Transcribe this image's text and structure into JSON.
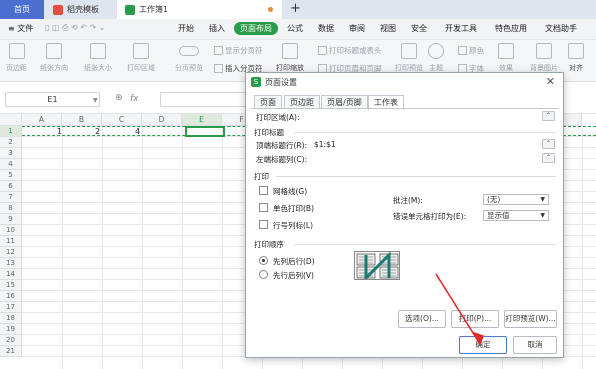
{
  "tabs": {
    "home": "首页",
    "template": "稻壳模板",
    "workbook": "工作簿1",
    "add": "+"
  },
  "menu": {
    "file": "≡ 文件",
    "items": [
      "开始",
      "插入",
      "页面布局",
      "公式",
      "数据",
      "审阅",
      "视图",
      "安全",
      "开发工具",
      "特色应用",
      "文档助手"
    ],
    "active": "页面布局"
  },
  "toolbar": {
    "margins": "页边距",
    "orientation": "纸张方向",
    "size": "纸张大小",
    "print_area": "打印区域",
    "preview": "分页预览",
    "show_break": "显示分页符",
    "insert_break": "插入分页符",
    "print_scale": "打印缩放",
    "print_title": "打印标题或表头",
    "print_header_footer": "打印页眉和页脚",
    "print_preview": "打印预览",
    "theme": "主题",
    "colors": "颜色",
    "fonts": "字体",
    "effects": "效果",
    "background": "背景图片",
    "align": "对齐"
  },
  "formula": {
    "cell": "E1",
    "fx": "fx"
  },
  "sheet": {
    "columns": [
      "A",
      "B",
      "C",
      "D",
      "E",
      "F",
      "G",
      "H",
      "I",
      "J",
      "K",
      "L",
      "M",
      "N"
    ],
    "rows": [
      "1",
      "2",
      "3",
      "4",
      "5",
      "6",
      "7",
      "8",
      "9",
      "10",
      "11",
      "12",
      "13",
      "14",
      "15",
      "16",
      "17",
      "18",
      "19",
      "20",
      "21"
    ],
    "values": [
      "1",
      "2",
      "4"
    ]
  },
  "dialog": {
    "title": "页面设置",
    "tabs": [
      "页面",
      "页边距",
      "页眉/页脚",
      "工作表"
    ],
    "print_area": "打印区域(A):",
    "print_titles": "打印标题",
    "title_rows": "顶端标题行(R):",
    "title_rows_value": "$1:$1",
    "title_cols": "左端标题列(C):",
    "print_section": "打印",
    "gridlines": "网格线(G)",
    "mono": "单色打印(B)",
    "rowcol": "行号列标(L)",
    "comments_label": "批注(M):",
    "comments_value": "(无)",
    "errors_label": "错误单元格打印为(E):",
    "errors_value": "显示值",
    "order_section": "打印顺序",
    "down_then_over": "先列后行(D)",
    "over_then_down": "先行后列(V)",
    "options_btn": "选项(O)...",
    "print_btn": "打印(P)...",
    "preview_btn": "打印预览(W)...",
    "ok_btn": "确定",
    "cancel_btn": "取消",
    "close": "✕"
  },
  "colors": {
    "accent": "#2a9b4a",
    "home_tab": "#4a6fd0",
    "arrow": "#e0292b"
  }
}
